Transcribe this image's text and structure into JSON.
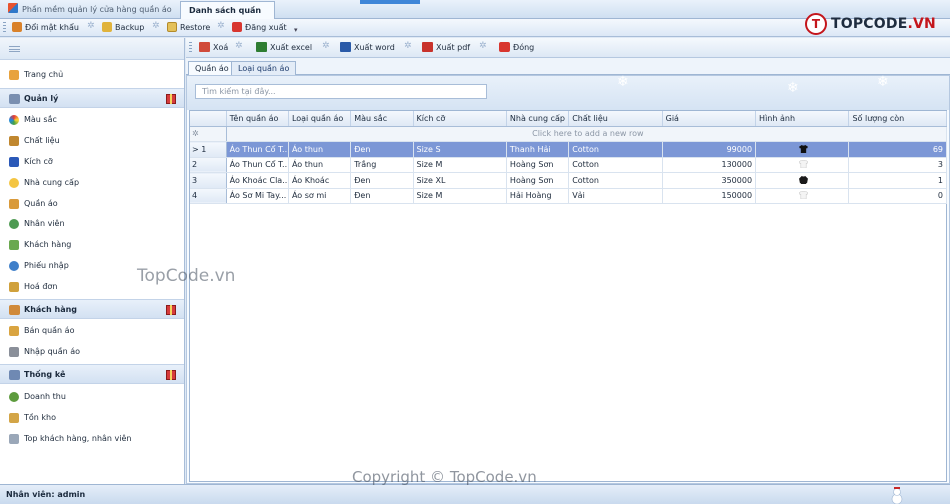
{
  "window": {
    "app_tab": "Phần mềm quản lý cửa hàng quần áo",
    "active_tab": "Danh sách quần áo"
  },
  "ribbon": {
    "items": [
      {
        "label": "Đổi mật khẩu",
        "icon": "key-icon"
      },
      {
        "label": "Backup",
        "icon": "backup-icon"
      },
      {
        "label": "Restore",
        "icon": "restore-icon"
      },
      {
        "label": "Đăng xuất",
        "icon": "logout-icon"
      }
    ]
  },
  "logo": {
    "badge": "T",
    "text_dark": "TOPCODE",
    "text_red": ".VN"
  },
  "sidebar": {
    "items": [
      {
        "label": "Trang chủ",
        "icon": "home-icon"
      },
      {
        "label": "Quản lý",
        "group": true
      },
      {
        "label": "Màu sắc",
        "icon": "color-icon"
      },
      {
        "label": "Chất liệu",
        "icon": "material-icon"
      },
      {
        "label": "Kích cỡ",
        "icon": "size-icon"
      },
      {
        "label": "Nhà cung cấp",
        "icon": "supplier-icon"
      },
      {
        "label": "Quần áo",
        "icon": "clothes-icon"
      },
      {
        "label": "Nhân viên",
        "icon": "employee-icon"
      },
      {
        "label": "Khách hàng",
        "icon": "customer-icon"
      },
      {
        "label": "Phiếu nhập",
        "icon": "import-icon"
      },
      {
        "label": "Hoá đơn",
        "icon": "invoice-icon"
      },
      {
        "label": "Khách hàng",
        "group": true
      },
      {
        "label": "Bán quần áo",
        "icon": "sell-icon"
      },
      {
        "label": "Nhập quần áo",
        "icon": "import-clothes-icon"
      },
      {
        "label": "Thống kê",
        "group": true
      },
      {
        "label": "Doanh thu",
        "icon": "revenue-icon"
      },
      {
        "label": "Tồn kho",
        "icon": "stock-icon"
      },
      {
        "label": "Top khách hàng, nhân viên",
        "icon": "top-icon"
      }
    ]
  },
  "toolbar": {
    "buttons": [
      {
        "label": "Xoá",
        "icon": "delete-icon"
      },
      {
        "label": "Xuất excel",
        "icon": "excel-icon"
      },
      {
        "label": "Xuất word",
        "icon": "word-icon"
      },
      {
        "label": "Xuất pdf",
        "icon": "pdf-icon"
      },
      {
        "label": "Đóng",
        "icon": "close-icon"
      }
    ]
  },
  "subtabs": [
    "Quần áo",
    "Loại quần áo"
  ],
  "search": {
    "placeholder": "Tìm kiếm tại đây..."
  },
  "grid": {
    "columns": [
      "Tên quần áo",
      "Loại quần áo",
      "Màu sắc",
      "Kích cỡ",
      "Nhà cung cấp",
      "Chất liệu",
      "Giá",
      "Hình ảnh",
      "Số lượng còn"
    ],
    "add_row_text": "Click here to add a new row",
    "rows": [
      {
        "idx": "1",
        "name": "Áo Thun Cổ T...",
        "type": "Áo thun",
        "color": "Đen",
        "size": "Size S",
        "supplier": "Thanh Hải",
        "material": "Cotton",
        "price": "99000",
        "image": "black-shirt-icon",
        "qty": "69"
      },
      {
        "idx": "2",
        "name": "Áo Thun Cổ T...",
        "type": "Áo thun",
        "color": "Trắng",
        "size": "Size M",
        "supplier": "Hoàng Sơn",
        "material": "Cotton",
        "price": "130000",
        "image": "white-shirt-icon",
        "qty": "3"
      },
      {
        "idx": "3",
        "name": "Áo Khoác Cla...",
        "type": "Áo Khoác",
        "color": "Đen",
        "size": "Size XL",
        "supplier": "Hoàng Sơn",
        "material": "Cotton",
        "price": "350000",
        "image": "black-jacket-icon",
        "qty": "1"
      },
      {
        "idx": "4",
        "name": "Áo Sơ Mi Tay...",
        "type": "Áo sơ mi",
        "color": "Đen",
        "size": "Size M",
        "supplier": "Hải Hoàng",
        "material": "Vải",
        "price": "150000",
        "image": "white-shirt-icon",
        "qty": "0"
      }
    ],
    "selected_row": 0
  },
  "status": {
    "user": "Nhân viên: admin"
  },
  "watermarks": {
    "mid": "TopCode.vn",
    "bottom": "Copyright © TopCode.vn"
  }
}
